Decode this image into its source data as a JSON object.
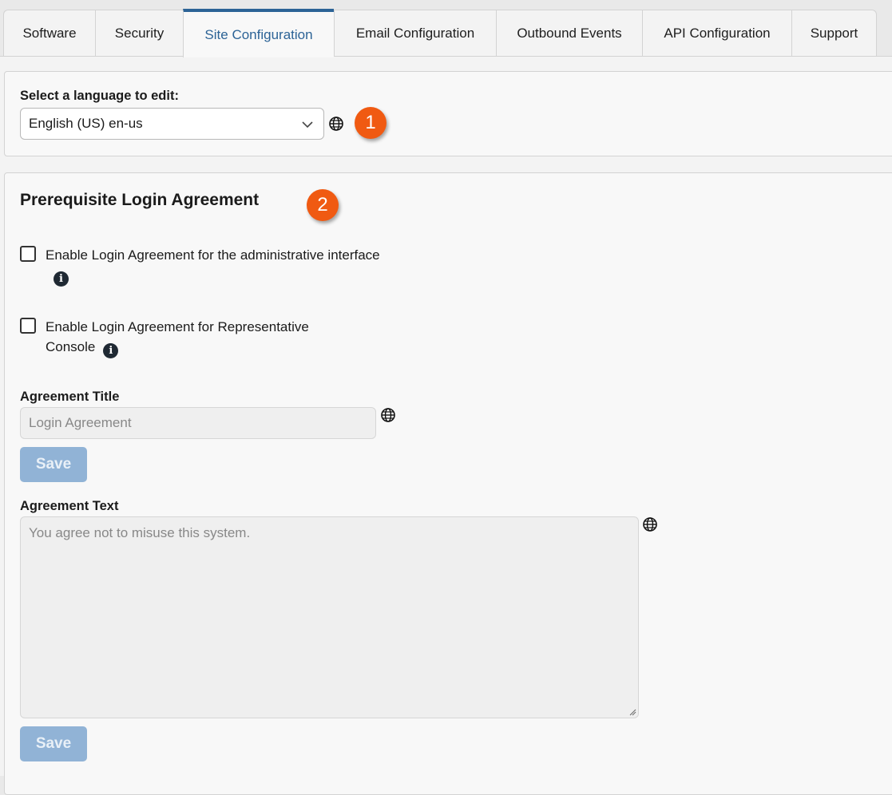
{
  "tabs": [
    {
      "label": "Software",
      "active": false
    },
    {
      "label": "Security",
      "active": false
    },
    {
      "label": "Site Configuration",
      "active": true
    },
    {
      "label": "Email Configuration",
      "active": false
    },
    {
      "label": "Outbound Events",
      "active": false
    },
    {
      "label": "API Configuration",
      "active": false
    },
    {
      "label": "Support",
      "active": false
    }
  ],
  "language": {
    "label": "Select a language to edit:",
    "selected": "English (US) en-us",
    "badge": "1"
  },
  "agreement": {
    "heading": "Prerequisite Login Agreement",
    "badge": "2",
    "admin_checkbox_label": "Enable Login Agreement for the administrative interface",
    "admin_checked": false,
    "rep_checkbox_label": "Enable Login Agreement for Representative Console",
    "rep_checked": false,
    "title_label": "Agreement Title",
    "title_value": "Login Agreement",
    "save_label": "Save",
    "text_label": "Agreement Text",
    "text_value": "You agree not to misuse this system.",
    "save_label_2": "Save"
  },
  "colors": {
    "accent": "#2c6396",
    "badge": "#f05a12",
    "button_disabled": "#91b3d6"
  }
}
